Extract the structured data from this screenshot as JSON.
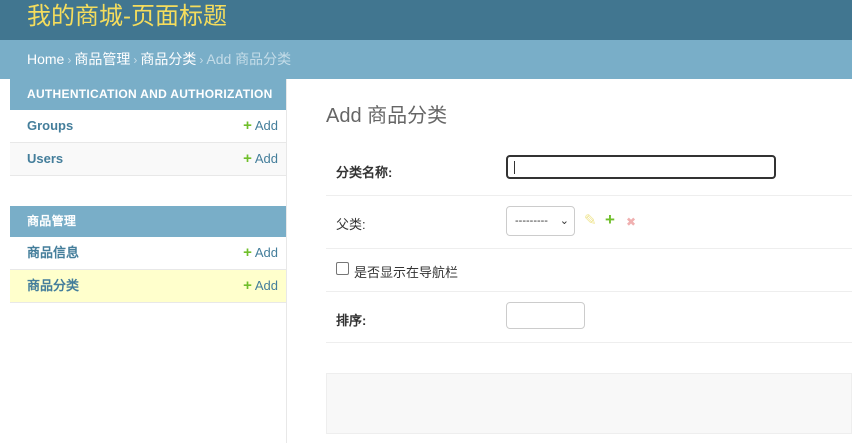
{
  "header": {
    "site_title": "我的商城-页面标题"
  },
  "breadcrumbs": {
    "home": "Home",
    "sep": "›",
    "app": "商品管理",
    "model": "商品分类",
    "current": "Add 商品分类"
  },
  "sidebar": {
    "modules": [
      {
        "caption": "AUTHENTICATION AND AUTHORIZATION",
        "items": [
          {
            "label": "Groups",
            "add": "Add"
          },
          {
            "label": "Users",
            "add": "Add"
          }
        ]
      },
      {
        "caption": "商品管理",
        "items": [
          {
            "label": "商品信息",
            "add": "Add"
          },
          {
            "label": "商品分类",
            "add": "Add",
            "selected": true
          }
        ]
      }
    ]
  },
  "content": {
    "title": "Add 商品分类",
    "fields": {
      "name": {
        "label": "分类名称:",
        "value": ""
      },
      "parent": {
        "label": "父类:",
        "selected": "---------"
      },
      "show_in_nav": {
        "label": "是否显示在导航栏",
        "checked": false
      },
      "sort": {
        "label": "排序:",
        "value": ""
      }
    }
  },
  "icons": {
    "plus": "+",
    "pencil": "✎",
    "delete": "✖",
    "chevron": "⌄"
  },
  "colors": {
    "header_bg": "#417690",
    "title_yellow": "#f5dd5d",
    "breadcrumb_bg": "#79aec8",
    "link": "#447e9b",
    "add_green": "#70bf2b",
    "selected_row": "#ffffcc"
  }
}
